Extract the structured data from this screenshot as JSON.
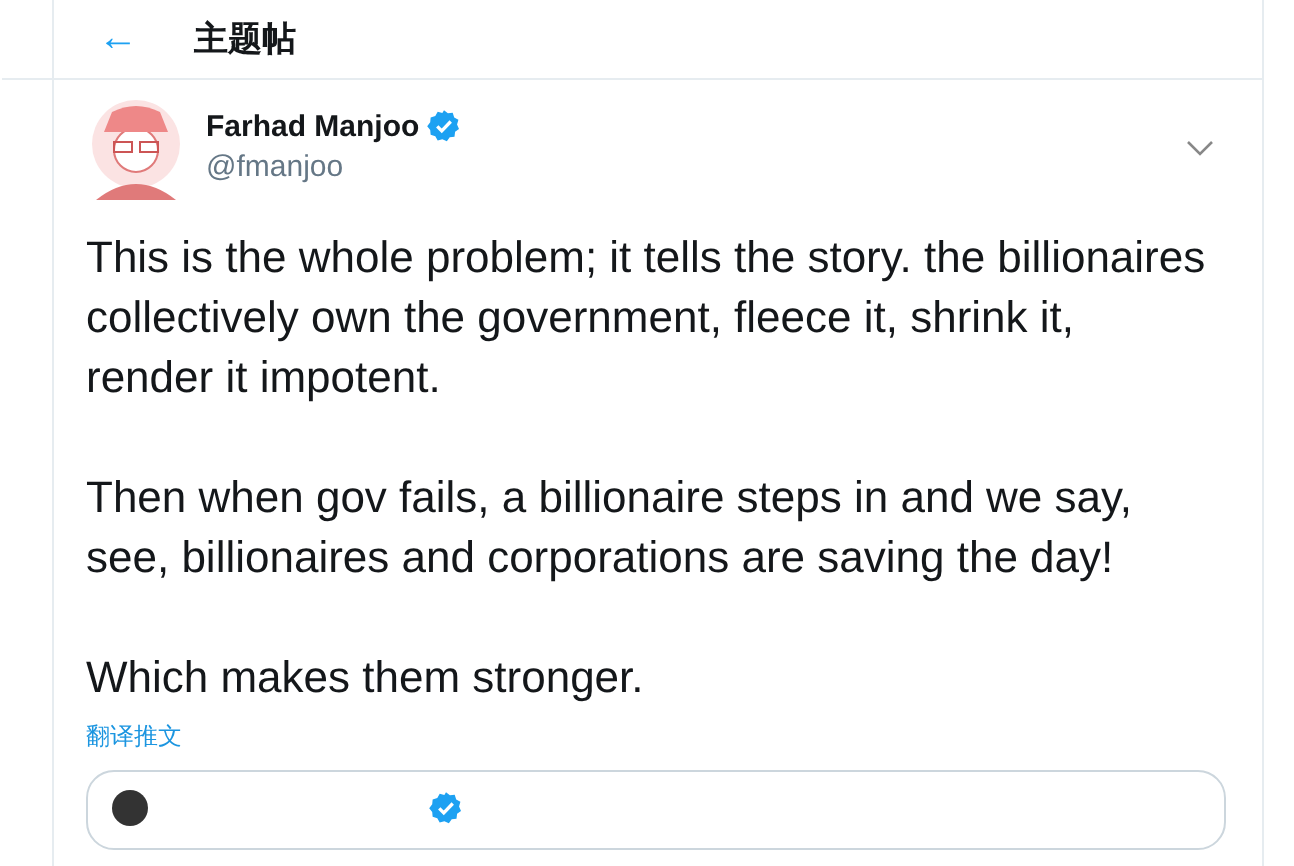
{
  "header": {
    "back_icon": "←",
    "title": "主题帖"
  },
  "tweet": {
    "author": {
      "name": "Farhad Manjoo",
      "verified": true,
      "handle": "@fmanjoo"
    },
    "paragraphs": [
      "This is the whole problem; it tells the story. the billionaires collectively own the government, fleece it, shrink it, render it impotent.",
      "Then when gov fails, a billionaire steps in and we say, see, billionaires and corporations are saving the day!",
      "Which makes them stronger."
    ],
    "translate_link": "翻译推文",
    "quoted_tweet": {
      "verified": true
    }
  }
}
